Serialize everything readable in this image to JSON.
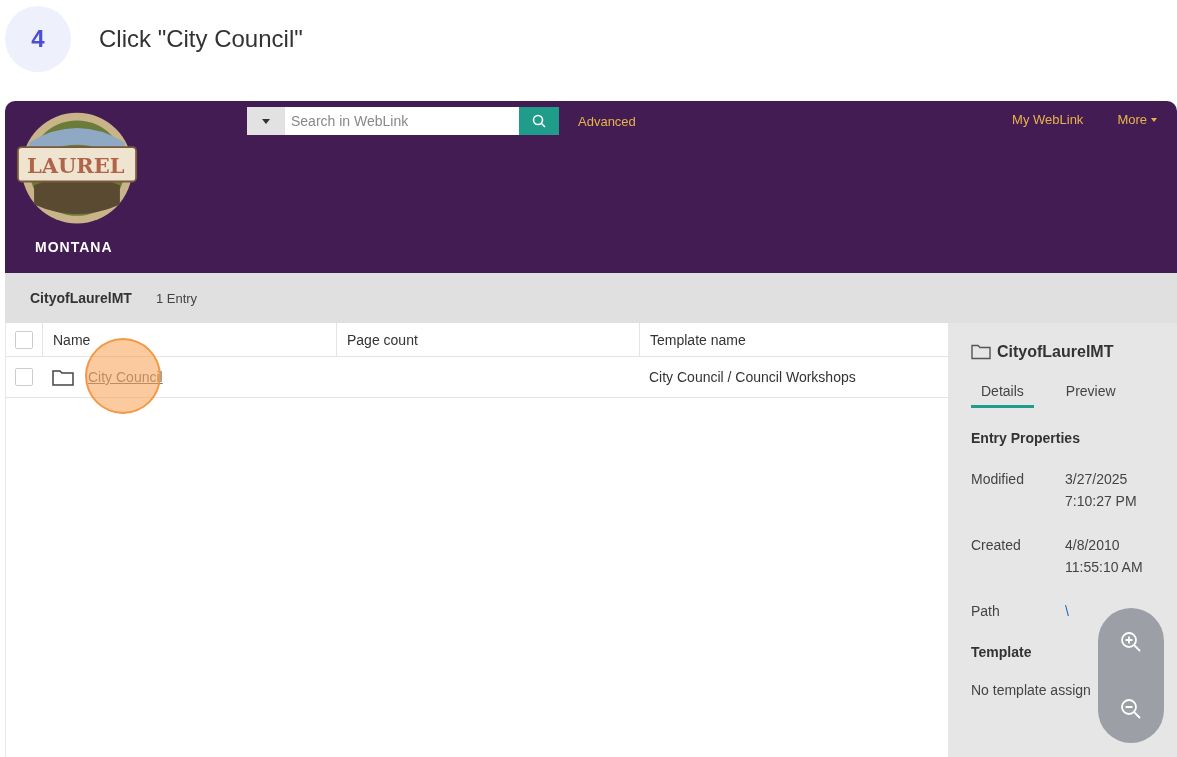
{
  "step": {
    "number": "4",
    "instruction": "Click \"City Council\""
  },
  "header": {
    "logo_text": "LAUREL",
    "logo_subtext": "MONTANA",
    "search": {
      "placeholder": "Search in WebLink"
    },
    "advanced_link": "Advanced",
    "nav": [
      {
        "label": "My WebLink",
        "kind": "link"
      },
      {
        "label": "More",
        "kind": "menu"
      }
    ]
  },
  "breadcrumb": {
    "folder": "CityofLaurelMT",
    "count": "1 Entry"
  },
  "table": {
    "select_all_checked": false,
    "columns": [
      "Name",
      "Page count",
      "Template name"
    ],
    "rows": [
      {
        "checked": false,
        "name": "City Council",
        "template": "City Council / Council Workshops",
        "clicked": true
      }
    ]
  },
  "details": {
    "title": "CityofLaurelMT",
    "tabs": [
      {
        "label": "Details",
        "selected": true
      },
      {
        "label": "Preview",
        "selected": false
      }
    ],
    "section": "Entry Properties",
    "properties": [
      {
        "label": "Modified",
        "value": [
          "3/27/2025",
          "7:10:27 PM"
        ],
        "kind": "text"
      },
      {
        "label": "Created",
        "value": [
          "4/8/2010",
          "11:55:10 AM"
        ],
        "kind": "text"
      },
      {
        "label": "Path",
        "value": [
          "\\"
        ],
        "kind": "link"
      }
    ],
    "template_heading": "Template",
    "template_value": "No template assign"
  }
}
